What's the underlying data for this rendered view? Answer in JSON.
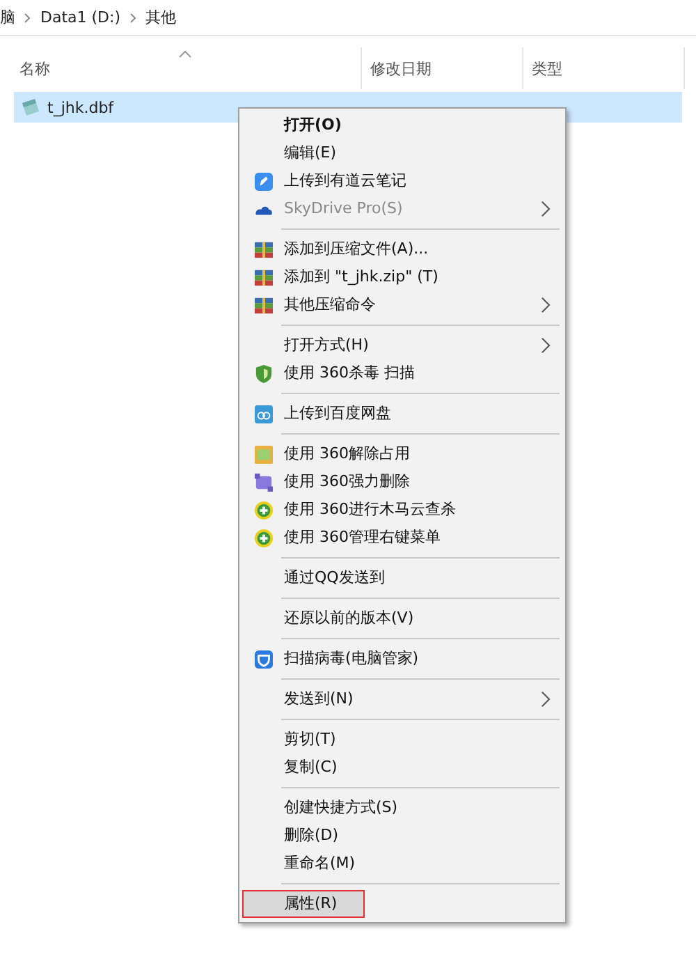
{
  "breadcrumb": [
    "脑",
    "Data1 (D:)",
    "其他"
  ],
  "columns": [
    "名称",
    "修改日期",
    "类型"
  ],
  "files": [
    {
      "name": "t_jhk.dbf",
      "selected": true
    }
  ],
  "context_menu": [
    {
      "kind": "item",
      "label": "打开(O)",
      "bold": true
    },
    {
      "kind": "item",
      "label": "编辑(E)"
    },
    {
      "kind": "item",
      "label": "上传到有道云笔记"
    },
    {
      "kind": "item",
      "label": "SkyDrive Pro(S)",
      "disabled": true,
      "submenu": true
    },
    {
      "kind": "separator"
    },
    {
      "kind": "item",
      "label": "添加到压缩文件(A)..."
    },
    {
      "kind": "item",
      "label": "添加到 \"t_jhk.zip\" (T)"
    },
    {
      "kind": "item",
      "label": "其他压缩命令",
      "submenu": true
    },
    {
      "kind": "separator"
    },
    {
      "kind": "item",
      "label": "打开方式(H)",
      "submenu": true
    },
    {
      "kind": "item",
      "label": "使用 360杀毒 扫描"
    },
    {
      "kind": "separator"
    },
    {
      "kind": "item",
      "label": "上传到百度网盘"
    },
    {
      "kind": "separator"
    },
    {
      "kind": "item",
      "label": "使用 360解除占用"
    },
    {
      "kind": "item",
      "label": "使用 360强力删除"
    },
    {
      "kind": "item",
      "label": "使用 360进行木马云查杀"
    },
    {
      "kind": "item",
      "label": "使用 360管理右键菜单"
    },
    {
      "kind": "separator"
    },
    {
      "kind": "item",
      "label": "通过QQ发送到"
    },
    {
      "kind": "separator"
    },
    {
      "kind": "item",
      "label": "还原以前的版本(V)"
    },
    {
      "kind": "separator"
    },
    {
      "kind": "item",
      "label": "扫描病毒(电脑管家)"
    },
    {
      "kind": "separator"
    },
    {
      "kind": "item",
      "label": "发送到(N)",
      "submenu": true
    },
    {
      "kind": "separator"
    },
    {
      "kind": "item",
      "label": "剪切(T)"
    },
    {
      "kind": "item",
      "label": "复制(C)"
    },
    {
      "kind": "separator"
    },
    {
      "kind": "item",
      "label": "创建快捷方式(S)"
    },
    {
      "kind": "item",
      "label": "删除(D)"
    },
    {
      "kind": "item",
      "label": "重命名(M)"
    },
    {
      "kind": "separator"
    },
    {
      "kind": "item",
      "label": "属性(R)",
      "selected": true,
      "highlighted": true
    }
  ]
}
